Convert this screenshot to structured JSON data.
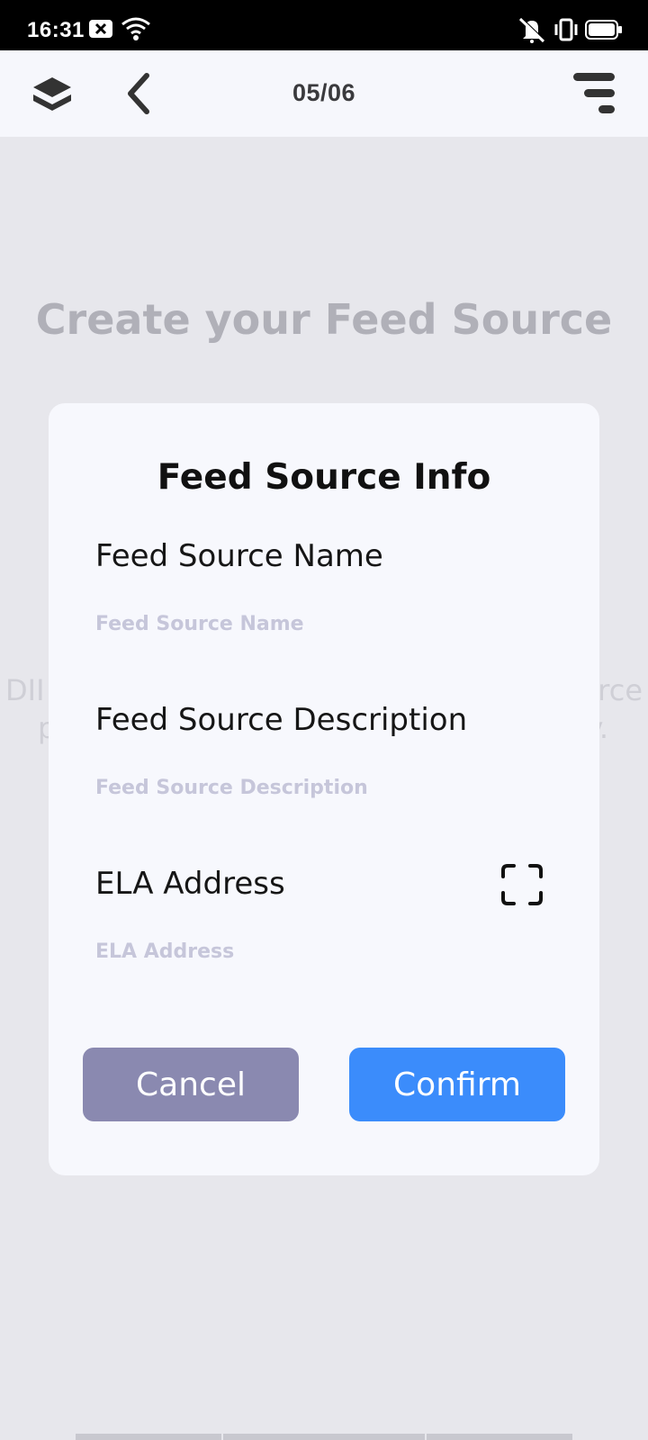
{
  "status_bar": {
    "time": "16:31"
  },
  "header": {
    "page_counter": "05/06"
  },
  "background": {
    "title": "Create your Feed Source",
    "desc_left_1": "DII",
    "desc_right_1": "rce",
    "desc_left_2": "p",
    "desc_right_2": "y."
  },
  "modal": {
    "title": "Feed Source Info",
    "fields": [
      {
        "label": "Feed Source Name",
        "placeholder": "Feed Source Name"
      },
      {
        "label": "Feed Source Description",
        "placeholder": "Feed Source Description"
      },
      {
        "label": "ELA Address",
        "placeholder": "ELA Address"
      }
    ],
    "cancel_label": "Cancel",
    "confirm_label": "Confirm"
  },
  "colors": {
    "cancel": "#8a89b0",
    "confirm": "#3b8cfb",
    "placeholder": "#c6c6da"
  }
}
